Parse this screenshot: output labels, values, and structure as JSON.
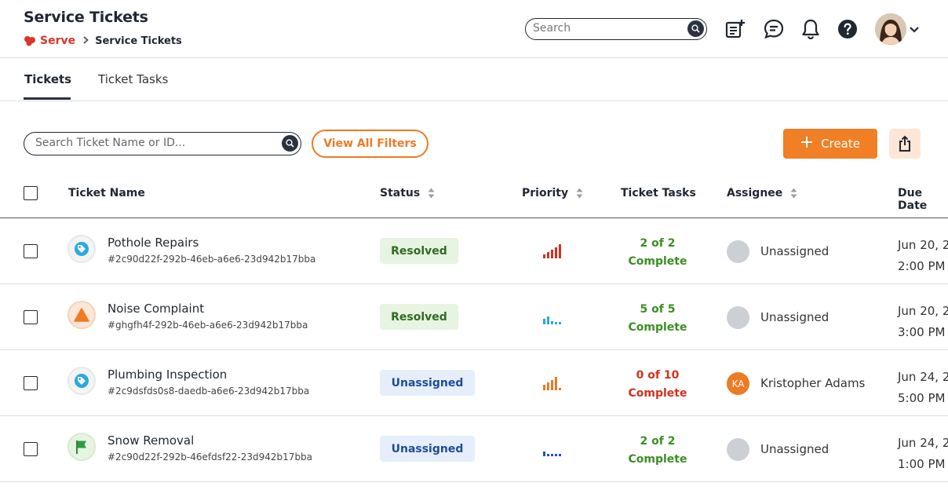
{
  "header": {
    "title": "Service Tickets",
    "breadcrumb": {
      "root": "Serve",
      "current": "Service Tickets"
    },
    "search_placeholder": "Search"
  },
  "tabs": [
    {
      "label": "Tickets",
      "active": true
    },
    {
      "label": "Ticket Tasks",
      "active": false
    }
  ],
  "toolbar": {
    "search_placeholder": "Search Ticket Name or ID...",
    "filters_label": "View All Filters",
    "create_label": "Create"
  },
  "columns": {
    "ticket_name": "Ticket Name",
    "status": "Status",
    "priority": "Priority",
    "ticket_tasks": "Ticket Tasks",
    "assignee": "Assignee",
    "due_date": "Due Date"
  },
  "colors": {
    "accent": "#f07f26",
    "resolved": "#2f6b21",
    "unassigned": "#1e4c9a",
    "tasks_complete": "#3a8f24",
    "tasks_incomplete": "#d5301f"
  },
  "rows": [
    {
      "name": "Pothole Repairs",
      "id": "#2c90d22f-292b-46eb-a6e6-23d942b17bba",
      "icon": "tag-icon",
      "status": "Resolved",
      "priority_icon": "priority-high-icon",
      "tasks_line1": "2 of 2",
      "tasks_line2": "Complete",
      "assignee": "Unassigned",
      "assignee_initials": "",
      "due_line1": "Jun 20, 2",
      "due_line2": "2:00 PM"
    },
    {
      "name": "Noise Complaint",
      "id": "#ghgfh4f-292b-46eb-a6e6-23d942b17bba",
      "icon": "warning-icon",
      "status": "Resolved",
      "priority_icon": "priority-low-icon",
      "tasks_line1": "5 of 5",
      "tasks_line2": "Complete",
      "assignee": "Unassigned",
      "assignee_initials": "",
      "due_line1": "Jun 20, 2",
      "due_line2": "3:00 PM"
    },
    {
      "name": "Plumbing Inspection",
      "id": "#2c9dsfds0s8-daedb-a6e6-23d942b17bba",
      "icon": "tag-icon",
      "status": "Unassigned",
      "priority_icon": "priority-medium-icon",
      "tasks_line1": "0 of 10",
      "tasks_line2": "Complete",
      "assignee": "Kristopher Adams",
      "assignee_initials": "KA",
      "due_line1": "Jun 24, 2",
      "due_line2": "5:00 PM"
    },
    {
      "name": "Snow Removal",
      "id": "#2c90d22f-292b-46efdsf22-23d942b17bba",
      "icon": "flag-icon",
      "status": "Unassigned",
      "priority_icon": "priority-lowest-icon",
      "tasks_line1": "2 of 2",
      "tasks_line2": "Complete",
      "assignee": "Unassigned",
      "assignee_initials": "",
      "due_line1": "Jun 24, 2",
      "due_line2": "1:00 PM"
    }
  ]
}
